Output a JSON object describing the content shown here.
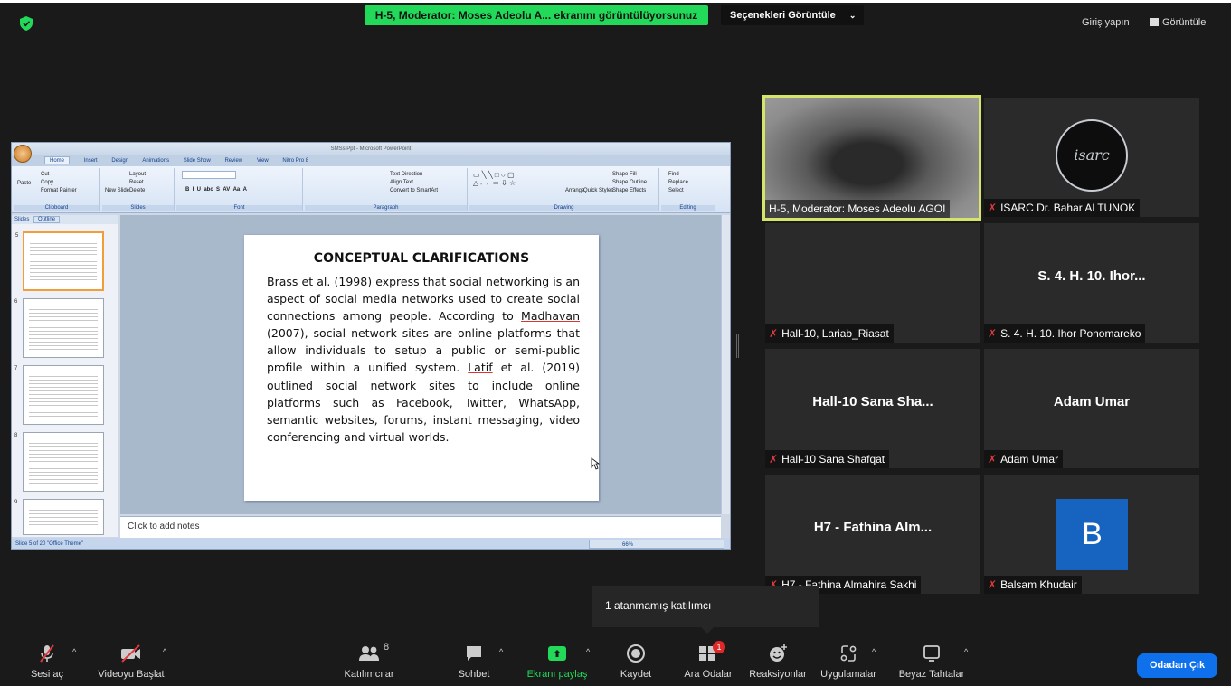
{
  "top_bar": {
    "share_banner": "H-5, Moderator: Moses Adeolu A... ekranını görüntülüyorsunuz",
    "view_options": "Seçenekleri Görüntüle",
    "login": "Giriş yapın",
    "view": "Görüntüle"
  },
  "ppt": {
    "title": "SMSs Ppt - Microsoft PowerPoint",
    "tabs": [
      "Home",
      "Insert",
      "Design",
      "Animations",
      "Slide Show",
      "Review",
      "View",
      "Nitro Pro 8"
    ],
    "groups": [
      "Clipboard",
      "Slides",
      "Font",
      "Paragraph",
      "Drawing",
      "Editing"
    ],
    "clipboard_items": [
      "Cut",
      "Copy",
      "Format Painter",
      "Paste"
    ],
    "slides_items": [
      "Layout",
      "Reset",
      "Delete",
      "New Slide"
    ],
    "paragraph_items": [
      "Text Direction",
      "Align Text",
      "Convert to SmartArt"
    ],
    "drawing_items": [
      "Arrange",
      "Quick Styles",
      "Shape Fill",
      "Shape Outline",
      "Shape Effects"
    ],
    "editing_items": [
      "Find",
      "Replace",
      "Select"
    ],
    "pane_tabs": [
      "Slides",
      "Outline"
    ],
    "thumb_numbers": [
      "5",
      "6",
      "7",
      "8",
      "9"
    ],
    "slide_title": "CONCEPTUAL CLARIFICATIONS",
    "slide_body": {
      "p1": "Brass et al. (1998) express that social networking is an aspect  of social media networks  used to create social connections among people. According to ",
      "madhavan": "Madhavan",
      "p2": " (2007), social network sites are online platforms that allow individuals to setup a public or semi-public profile within a unified system. ",
      "latif": "Latif",
      "p3": " et  al. (2019) outlined social network sites to include online platforms such as Facebook, Twitter, WhatsApp, semantic websites, forums, instant  messaging,  video conferencing  and virtual worlds."
    },
    "notes_placeholder": "Click to add notes",
    "status": "Slide 5 of 20   \"Office Theme\"",
    "zoom": "66%"
  },
  "participants": [
    {
      "tile_label": "",
      "name": "H-5, Moderator: Moses Adeolu AGOI",
      "muted": false,
      "kind": "video"
    },
    {
      "tile_label": "",
      "name": "ISARC Dr. Bahar ALTUNOK",
      "muted": true,
      "kind": "logo",
      "logo_text": "isarc"
    },
    {
      "tile_label": "",
      "name": "Hall-10, Lariab_Riasat",
      "muted": true,
      "kind": "blank"
    },
    {
      "tile_label": "S. 4. H. 10. Ihor...",
      "name": "S. 4. H. 10. Ihor Ponomareko",
      "muted": true,
      "kind": "text"
    },
    {
      "tile_label": "Hall-10 Sana Sha...",
      "name": "Hall-10 Sana Shafqat",
      "muted": true,
      "kind": "text"
    },
    {
      "tile_label": "Adam Umar",
      "name": "Adam Umar",
      "muted": true,
      "kind": "text"
    },
    {
      "tile_label": "H7 - Fathina Alm...",
      "name": "H7 - Fathina Almahira Sakhi",
      "muted": true,
      "kind": "text"
    },
    {
      "tile_label": "",
      "name": "Balsam Khudair",
      "muted": true,
      "kind": "avatar",
      "avatar_letter": "B"
    }
  ],
  "tooltip": "1 atanmamış katılımcı",
  "toolbar": {
    "unmute": "Sesi aç",
    "start_video": "Videoyu Başlat",
    "participants": "Katılımcılar",
    "participants_count": "8",
    "chat": "Sohbet",
    "share_screen": "Ekranı paylaş",
    "record": "Kaydet",
    "breakout": "Ara Odalar",
    "breakout_badge": "1",
    "reactions": "Reaksiyonlar",
    "apps": "Uygulamalar",
    "whiteboards": "Beyaz Tahtalar",
    "leave": "Odadan Çık"
  },
  "colors": {
    "banner_green": "#23d959",
    "active_speaker": "#d6e46a",
    "leave_blue": "#0e71eb",
    "muted_red": "#e0393e",
    "avatar_blue": "#1664c0"
  }
}
